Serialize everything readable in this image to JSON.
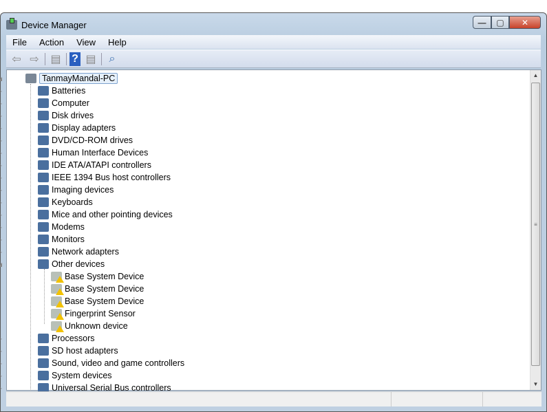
{
  "window": {
    "title": "Device Manager",
    "minimize": "—",
    "maximize": "▢",
    "close": "✕"
  },
  "menu": [
    "File",
    "Action",
    "View",
    "Help"
  ],
  "toolbar": [
    {
      "icon": "back-arrow-icon",
      "glyph": "⇦"
    },
    {
      "icon": "forward-arrow-icon",
      "glyph": "⇨"
    },
    {
      "icon": "show-hide-console-tree-icon",
      "glyph": "▤"
    },
    {
      "icon": "help-icon",
      "glyph": "?"
    },
    {
      "icon": "properties-icon",
      "glyph": "▤"
    },
    {
      "icon": "scan-hardware-icon",
      "glyph": "⌕"
    }
  ],
  "tree": {
    "root": "TanmayMandal-PC",
    "categories": [
      "Batteries",
      "Computer",
      "Disk drives",
      "Display adapters",
      "DVD/CD-ROM drives",
      "Human Interface Devices",
      "IDE ATA/ATAPI controllers",
      "IEEE 1394 Bus host controllers",
      "Imaging devices",
      "Keyboards",
      "Mice and other pointing devices",
      "Modems",
      "Monitors",
      "Network adapters",
      "Other devices"
    ],
    "other_devices": [
      "Base System Device",
      "Base System Device",
      "Base System Device",
      "Fingerprint Sensor",
      "Unknown device"
    ],
    "categories_after": [
      "Processors",
      "SD host adapters",
      "Sound, video and game controllers",
      "System devices",
      "Universal Serial Bus controllers"
    ]
  },
  "colors": {
    "category_icon": "#4a6f9e",
    "warning": "#f2c200"
  }
}
